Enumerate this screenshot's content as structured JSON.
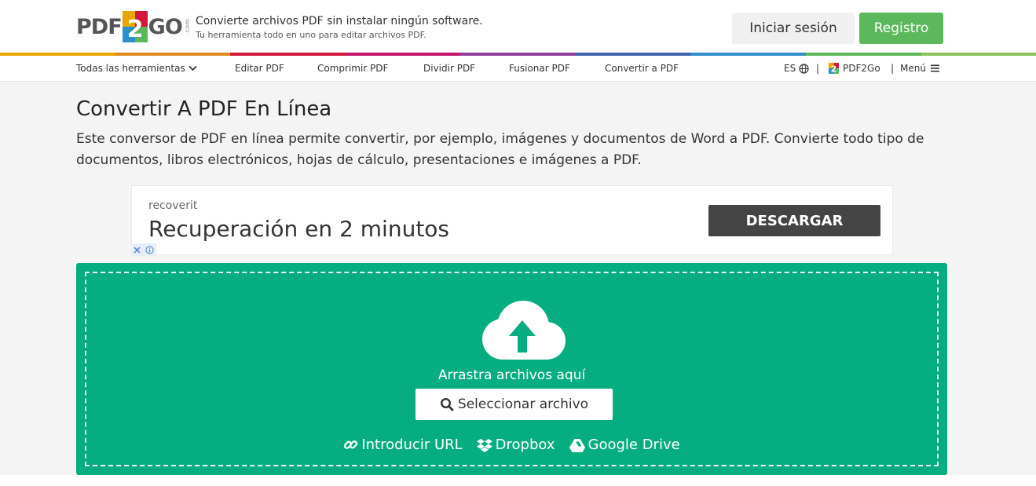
{
  "header": {
    "logo": {
      "left": "PDF",
      "mid": "2",
      "right": "GO",
      "suffix": ".com"
    },
    "tagline_main": "Convierte archivos PDF sin instalar ningún software.",
    "tagline_sub": "Tu herramienta todo en uno para editar archivos PDF.",
    "login_label": "Iniciar sesión",
    "register_label": "Registro"
  },
  "colors": {
    "accent_green": "#06ad80",
    "register_green": "#5cb85c",
    "rainbow": [
      "#e6a800",
      "#e08a1f",
      "#d4173c",
      "#c4156a",
      "#8e3d98",
      "#3f64b0",
      "#2e8fc8",
      "#5db85c",
      "#8ec35a"
    ]
  },
  "nav": {
    "items": [
      "Todas las herramientas",
      "Editar PDF",
      "Comprimir PDF",
      "Dividir PDF",
      "Fusionar PDF",
      "Convertir a PDF"
    ],
    "lang": "ES",
    "sep": "|",
    "brand": "PDF2Go",
    "menu": "Menú"
  },
  "page": {
    "title": "Convertir A PDF En Línea",
    "description": "Este conversor de PDF en línea permite convertir, por ejemplo, imágenes y documentos de Word a PDF. Convierte todo tipo de documentos, libros electrónicos, hojas de cálculo, presentaciones e imágenes a PDF."
  },
  "ad": {
    "brand": "recoverit",
    "headline": "Recuperación en 2 minutos",
    "cta": "DESCARGAR"
  },
  "upload": {
    "drag_text": "Arrastra archivos aquí",
    "select_label": "Seleccionar archivo",
    "sources": [
      "Introducir URL",
      "Dropbox",
      "Google Drive"
    ]
  }
}
